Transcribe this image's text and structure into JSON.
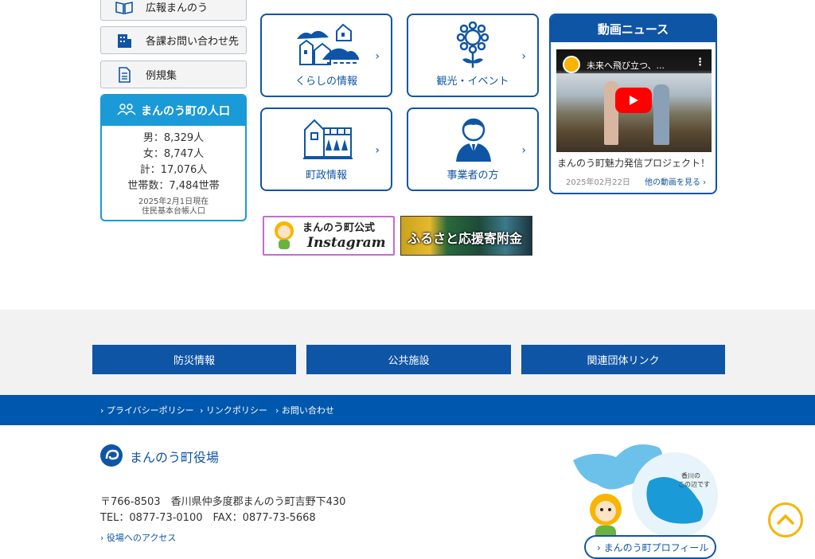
{
  "sidebar": {
    "items": [
      {
        "label": "広報まんのう",
        "icon": "book-icon"
      },
      {
        "label": "各課お問い合わせ先",
        "icon": "building-icon"
      },
      {
        "label": "例規集",
        "icon": "document-icon"
      }
    ]
  },
  "population": {
    "title": "まんのう町の人口",
    "male": "男：8,329人",
    "female": "女：8,747人",
    "total": "計：17,076人",
    "households": "世帯数：7,484世帯",
    "note1": "2025年2月1日現在",
    "note2": "住民基本台帳人口"
  },
  "categories": [
    {
      "label": "くらしの情報"
    },
    {
      "label": "観光・イベント"
    },
    {
      "label": "町政情報"
    },
    {
      "label": "事業者の方"
    }
  ],
  "video_news": {
    "title": "動画ニュース",
    "video_title": "未来へ飛び立つ、...",
    "caption": "まんのう町魅力発信プロジェクト！",
    "date": "2025年02月22日",
    "more": "他の動画を見る"
  },
  "banners": {
    "instagram_line1": "まんのう町公式",
    "instagram_line2": "Instagram",
    "furusato": "ふるさと応援寄附金"
  },
  "footer_nav": [
    "防災情報",
    "公共施設",
    "関連団体リンク"
  ],
  "footer_links": [
    "プライバシーポリシー",
    "リンクポリシー",
    "お問い合わせ"
  ],
  "office": {
    "name": "まんのう町役場",
    "address": "〒766-8503　香川県仲多度郡まんのう町吉野下430",
    "phone": "TEL：0877-73-0100　FAX：0877-73-5668",
    "access": "役場へのアクセス"
  },
  "map": {
    "note1": "香川の",
    "note2": "この辺です",
    "profile": "まんのう町プロフィール"
  },
  "colors": {
    "primary": "#0f55a6",
    "accent": "#1a9ad6"
  }
}
